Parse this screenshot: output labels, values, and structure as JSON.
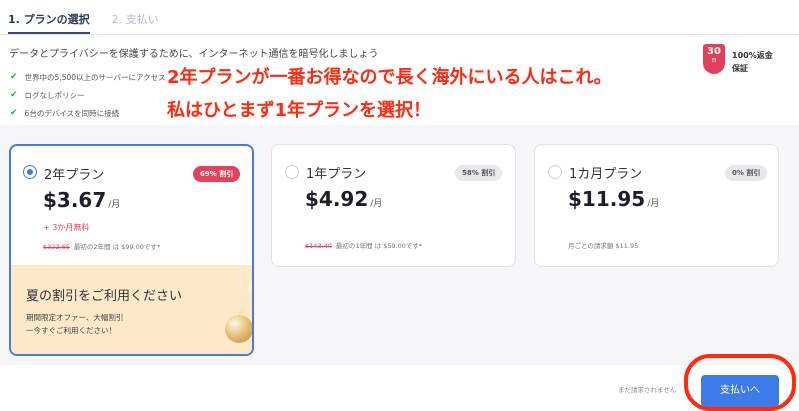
{
  "tabs": [
    "1. プランの選択",
    "2. 支払い"
  ],
  "headline": "データとプライバシーを保護するために、インターネット通信を暗号化しましょう",
  "features": [
    "世界中の5,500以上のサーバーにアクセス",
    "ログなしポリシー",
    "6台のデバイスを同時に接続"
  ],
  "guarantee": {
    "days": "30",
    "days_unit": "日",
    "line1": "100%返金",
    "line2": "保証"
  },
  "annotations": [
    "2年プランが一番お得なので長く海外にいる人はこれ。",
    "私はひとまず1年プランを選択！"
  ],
  "plans": [
    {
      "name": "2年プラン",
      "badge": "69% 割引",
      "price": "$3.67",
      "per": "/月",
      "bonus": "+ 3か月無料",
      "old": "$322.65",
      "note": "最初の2年間 は $99.00です*"
    },
    {
      "name": "1年プラン",
      "badge": "58% 割引",
      "price": "$4.92",
      "per": "/月",
      "old": "$143.40",
      "note": "最初の1年間 は $59.00です*"
    },
    {
      "name": "1カ月プラン",
      "badge": "0% 割引",
      "price": "$11.95",
      "per": "/月",
      "note": "月ごとの請求額 $11.95"
    }
  ],
  "summer": {
    "title": "夏の割引をご利用ください",
    "line1": "期間限定オファー、大幅割引",
    "line2": "一今すぐご利用ください！"
  },
  "footer": {
    "remaining": "まだ請求されません",
    "pay_button": "支払いへ"
  },
  "colors": {
    "accent": "#3d7be8",
    "discount": "#e6415a",
    "annotation": "#ff2a10"
  }
}
